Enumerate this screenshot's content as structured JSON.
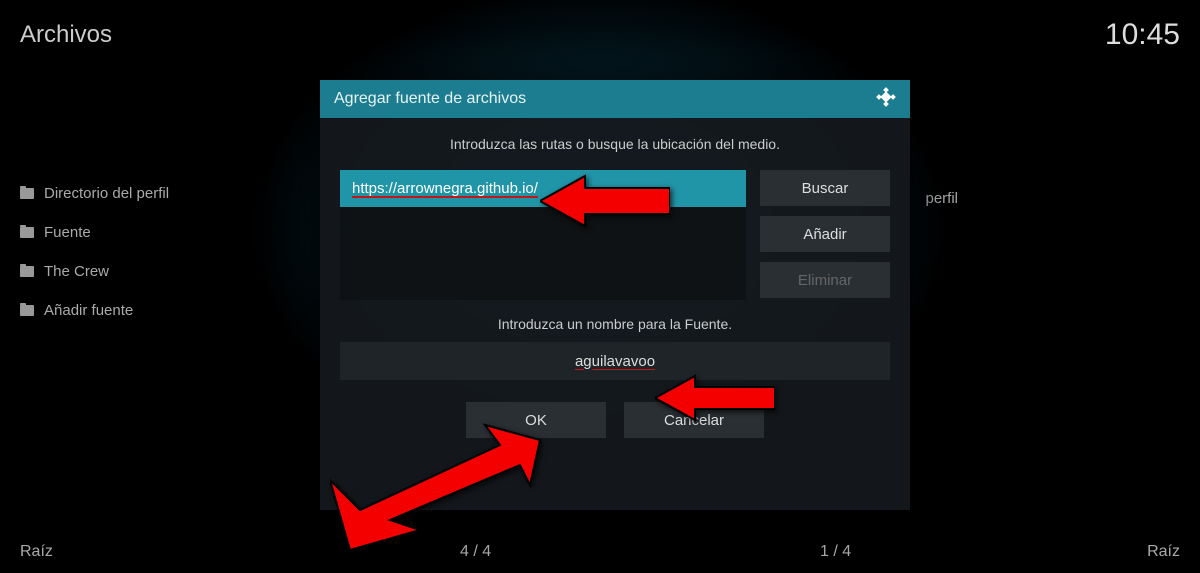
{
  "header": {
    "title": "Archivos",
    "clock": "10:45"
  },
  "sidebar_left": {
    "items": [
      {
        "label": "Directorio del perfil"
      },
      {
        "label": "Fuente"
      },
      {
        "label": "The Crew"
      },
      {
        "label": "Añadir fuente"
      }
    ]
  },
  "sidebar_right_fragment": "perfil",
  "footer": {
    "left": "Raíz",
    "counter1": "4 / 4",
    "counter2": "1 / 4",
    "right": "Raíz"
  },
  "dialog": {
    "title": "Agregar fuente de archivos",
    "prompt_path": "Introduzca las rutas o busque la ubicación del medio.",
    "path_value": "https://arrownegra.github.io/",
    "buttons": {
      "browse": "Buscar",
      "add": "Añadir",
      "remove": "Eliminar"
    },
    "prompt_name": "Introduzca un nombre para la Fuente.",
    "name_value": "aguilavavoo",
    "ok": "OK",
    "cancel": "Cancelar"
  }
}
